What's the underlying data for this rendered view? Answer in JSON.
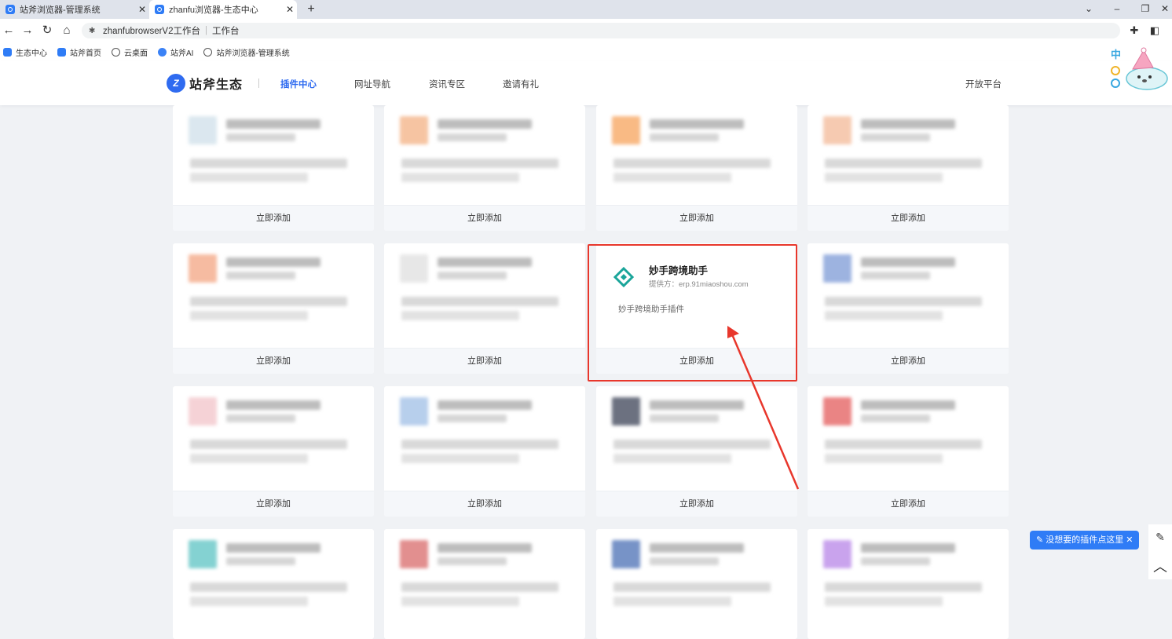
{
  "browser": {
    "tabs": [
      {
        "title": "站斧浏览器-管理系统",
        "close": "✕"
      },
      {
        "title": "zhanfu浏览器-生态中心",
        "close": "✕"
      }
    ],
    "new_tab": "+",
    "window_controls": [
      "⌄",
      "–",
      "❐",
      "✕"
    ],
    "address": {
      "site": "zhanfubrowserV2工作台",
      "separator": "|",
      "page": "工作台"
    },
    "bookmarks": [
      "生态中心",
      "站斧首页",
      "云桌面",
      "站斧AI",
      "站斧浏览器-管理系统"
    ]
  },
  "header": {
    "logo_mark": "Z",
    "logo_text": "站斧生态",
    "nav": [
      "插件中心",
      "网址导航",
      "资讯专区",
      "邀请有礼"
    ],
    "right_link": "开放平台"
  },
  "mascot": {
    "badge": "中"
  },
  "cards": {
    "button_label": "立即添加",
    "featured": {
      "title": "妙手跨境助手",
      "provider": "提供方：erp.91miaoshou.com",
      "description": "妙手跨境助手插件"
    }
  },
  "floating": {
    "tip": "没想要的插件点这里",
    "tip_close": "✕"
  },
  "colors": {
    "accent": "#2f6bf0",
    "highlight": "#e8372c",
    "featured_icon": "#1aa59a"
  }
}
